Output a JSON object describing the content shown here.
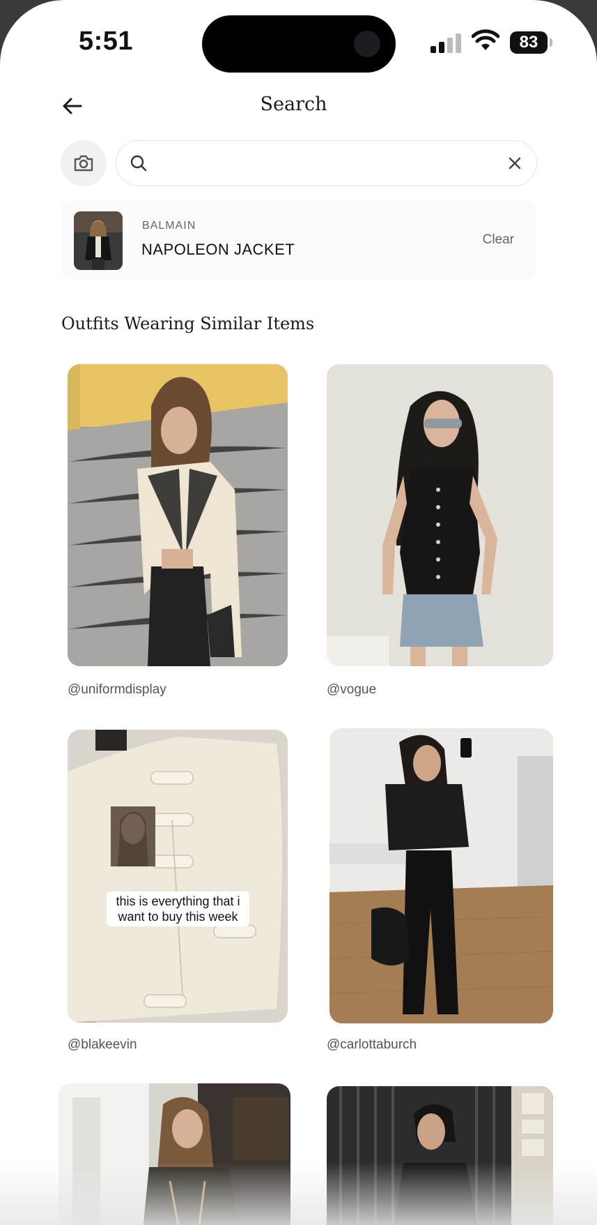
{
  "status_bar": {
    "time": "5:51",
    "battery": "83"
  },
  "header": {
    "title": "Search"
  },
  "search": {
    "value": "",
    "placeholder": ""
  },
  "selected_item": {
    "brand": "BALMAIN",
    "name": "NAPOLEON JACKET",
    "clear_label": "Clear"
  },
  "section": {
    "title": "Outfits Wearing Similar Items"
  },
  "outfits": [
    {
      "handle": "@uniformdisplay"
    },
    {
      "handle": "@vogue"
    },
    {
      "handle": "@blakeevin",
      "overlay_text_1": "this is everything that i",
      "overlay_text_2": "want to buy this week"
    },
    {
      "handle": "@carlottaburch"
    },
    {
      "handle": ""
    },
    {
      "handle": ""
    }
  ]
}
